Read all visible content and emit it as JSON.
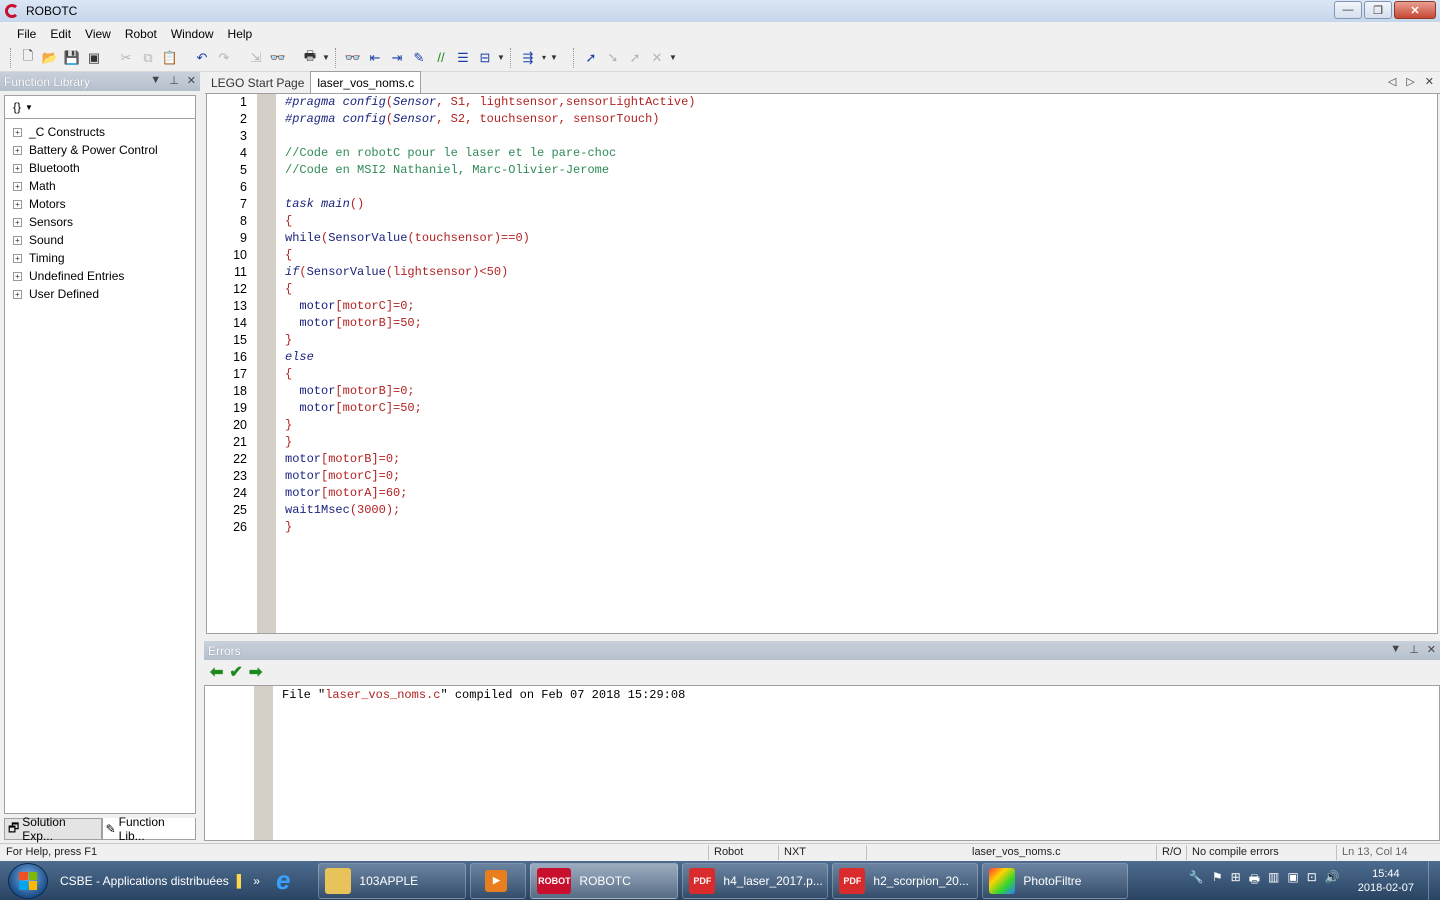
{
  "window": {
    "title": "ROBOTC",
    "min": "—",
    "max": "❐",
    "close": "✕"
  },
  "menu": [
    "File",
    "Edit",
    "View",
    "Robot",
    "Window",
    "Help"
  ],
  "toolbar": {
    "icons": [
      "new-file-icon",
      "open-folder-icon",
      "save-icon",
      "save-all-icon",
      "cut-icon",
      "copy-icon",
      "paste-icon",
      "undo-icon",
      "redo-icon",
      "find-in-files-icon",
      "find-icon",
      "print-icon",
      "binoculars-icon",
      "indent-left-icon",
      "indent-right-icon",
      "comment-icon",
      "uncomment-icon",
      "format-icon",
      "bookmark-icon",
      "compile-icon",
      "step-into-icon",
      "step-over-icon",
      "step-out-icon",
      "stop-debug-icon"
    ]
  },
  "left_panel": {
    "title": "Function Library",
    "tree": [
      "_C Constructs",
      "Battery & Power Control",
      "Bluetooth",
      "Math",
      "Motors",
      "Sensors",
      "Sound",
      "Timing",
      "Undefined Entries",
      "User Defined"
    ],
    "tabs": [
      "Solution Exp...",
      "Function Lib..."
    ]
  },
  "editor_tabs": [
    "LEGO Start Page",
    "laser_vos_noms.c"
  ],
  "code_lines": [
    [
      {
        "t": "#pragma",
        "c": "kw"
      },
      {
        "t": " ",
        "c": ""
      },
      {
        "t": "config",
        "c": "kw"
      },
      {
        "t": "(",
        "c": "red"
      },
      {
        "t": "Sensor",
        "c": "kw"
      },
      {
        "t": ", S1, lightsensor,sensorLightActive)",
        "c": "red"
      }
    ],
    [
      {
        "t": "#pragma",
        "c": "kw"
      },
      {
        "t": " ",
        "c": ""
      },
      {
        "t": "config",
        "c": "kw"
      },
      {
        "t": "(",
        "c": "red"
      },
      {
        "t": "Sensor",
        "c": "kw"
      },
      {
        "t": ", S2, touchsensor, sensorTouch)",
        "c": "red"
      }
    ],
    [],
    [
      {
        "t": "//Code en robotC pour le laser et le pare-choc",
        "c": "green2"
      }
    ],
    [
      {
        "t": "//Code en MSI2 Nathaniel, Marc-Olivier-Jerome",
        "c": "green2"
      }
    ],
    [],
    [
      {
        "t": "task",
        "c": "kw"
      },
      {
        "t": " ",
        "c": ""
      },
      {
        "t": "main",
        "c": "kw"
      },
      {
        "t": "()",
        "c": "red"
      }
    ],
    [
      {
        "t": "{",
        "c": "red"
      }
    ],
    [
      {
        "t": "while",
        "c": "fn"
      },
      {
        "t": "(",
        "c": "red"
      },
      {
        "t": "SensorValue",
        "c": "fn"
      },
      {
        "t": "(touchsensor)==0)",
        "c": "red"
      }
    ],
    [
      {
        "t": "{",
        "c": "red"
      }
    ],
    [
      {
        "t": "if",
        "c": "kw"
      },
      {
        "t": "(",
        "c": "red"
      },
      {
        "t": "SensorValue",
        "c": "fn"
      },
      {
        "t": "(lightsensor)<50)",
        "c": "red"
      }
    ],
    [
      {
        "t": "{",
        "c": "red"
      }
    ],
    [
      {
        "t": "  ",
        "c": ""
      },
      {
        "t": "motor",
        "c": "fn"
      },
      {
        "t": "[motorC]=0;",
        "c": "red"
      }
    ],
    [
      {
        "t": "  ",
        "c": ""
      },
      {
        "t": "motor",
        "c": "fn"
      },
      {
        "t": "[motorB]=50;",
        "c": "red"
      }
    ],
    [
      {
        "t": "}",
        "c": "red"
      }
    ],
    [
      {
        "t": "else",
        "c": "kw"
      }
    ],
    [
      {
        "t": "{",
        "c": "red"
      }
    ],
    [
      {
        "t": "  ",
        "c": ""
      },
      {
        "t": "motor",
        "c": "fn"
      },
      {
        "t": "[motorB]=0;",
        "c": "red"
      }
    ],
    [
      {
        "t": "  ",
        "c": ""
      },
      {
        "t": "motor",
        "c": "fn"
      },
      {
        "t": "[motorC]=50;",
        "c": "red"
      }
    ],
    [
      {
        "t": "}",
        "c": "red"
      }
    ],
    [
      {
        "t": "}",
        "c": "red"
      }
    ],
    [
      {
        "t": "motor",
        "c": "fn"
      },
      {
        "t": "[motorB]=0;",
        "c": "red"
      }
    ],
    [
      {
        "t": "motor",
        "c": "fn"
      },
      {
        "t": "[motorC]=0;",
        "c": "red"
      }
    ],
    [
      {
        "t": "motor",
        "c": "fn"
      },
      {
        "t": "[motorA]=60;",
        "c": "red"
      }
    ],
    [
      {
        "t": "wait1Msec",
        "c": "fn"
      },
      {
        "t": "(3000);",
        "c": "red"
      }
    ],
    [
      {
        "t": "}",
        "c": "red"
      }
    ]
  ],
  "errors": {
    "title": "Errors",
    "message_prefix": "File \"",
    "message_file": "laser_vos_noms.c",
    "message_suffix": "\" compiled on Feb 07 2018 15:29:08"
  },
  "status": {
    "help": "For Help, press F1",
    "robot": "Robot",
    "platform": "NXT",
    "file": "laser_vos_noms.c",
    "mode": "R/O",
    "compile": "No compile errors",
    "position": "Ln 13, Col 14"
  },
  "taskbar": {
    "quick_launch": "CSBE - Applications distribuées",
    "buttons": [
      {
        "label": "103APPLE",
        "icon": "folder-icon",
        "active": false
      },
      {
        "label": "ROBOTC",
        "icon": "robotc-icon",
        "active": true
      },
      {
        "label": "h4_laser_2017.p...",
        "icon": "pdf-icon",
        "active": false
      },
      {
        "label": "h2_scorpion_20...",
        "icon": "pdf-icon",
        "active": false
      },
      {
        "label": "PhotoFiltre",
        "icon": "photofiltre-icon",
        "active": false
      }
    ],
    "time": "15:44",
    "date": "2018-02-07"
  }
}
